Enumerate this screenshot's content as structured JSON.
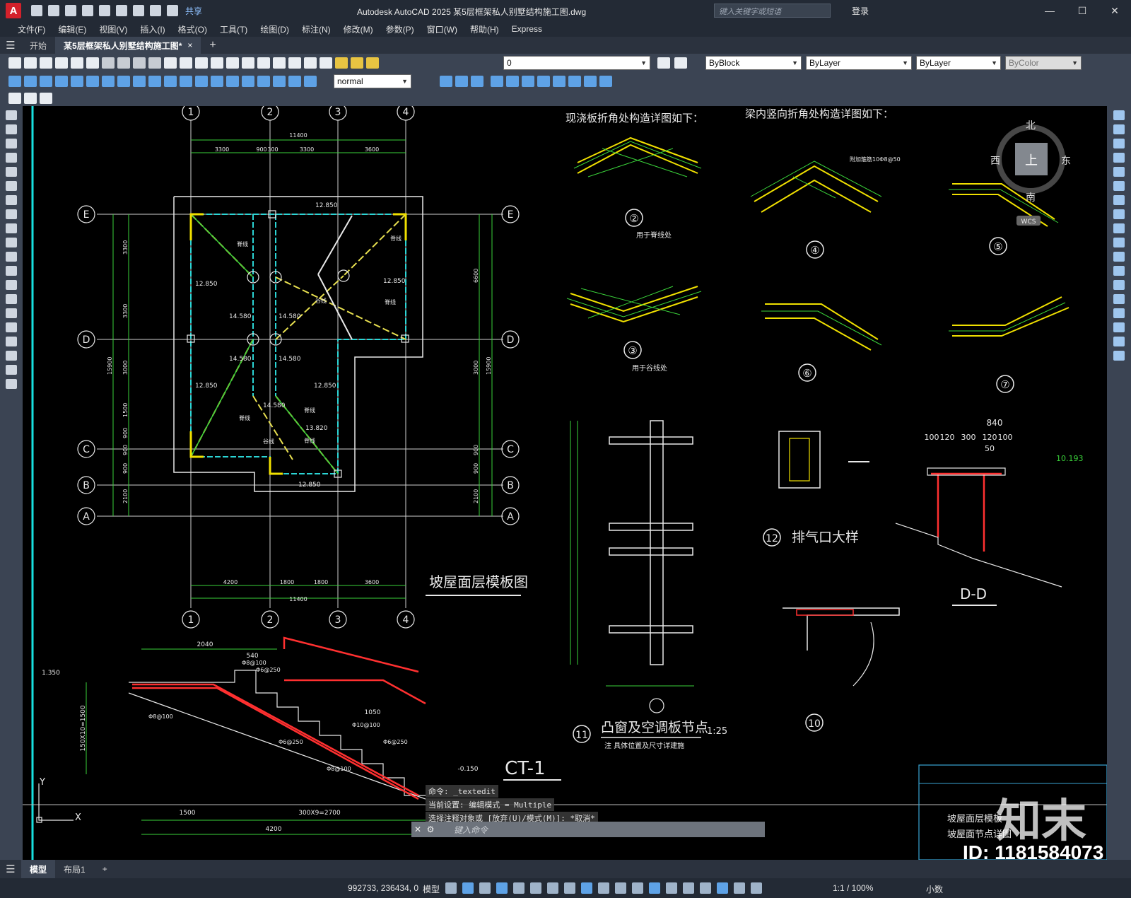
{
  "titlebar": {
    "logo": "A",
    "share": "共享",
    "title": "Autodesk AutoCAD 2025    某5层框架私人别墅结构施工图.dwg",
    "search_placeholder": "键入关键字或短语",
    "login": "登录",
    "minimize": "—",
    "maximize": "☐",
    "close": "✕"
  },
  "menu": [
    "文件(F)",
    "编辑(E)",
    "视图(V)",
    "插入(I)",
    "格式(O)",
    "工具(T)",
    "绘图(D)",
    "标注(N)",
    "修改(M)",
    "参数(P)",
    "窗口(W)",
    "帮助(H)",
    "Express"
  ],
  "tabs": {
    "start": "开始",
    "doc": "某5层框架私人别墅结构施工图*",
    "close": "×",
    "add": "+"
  },
  "toolbar": {
    "layer": "0",
    "color": "ByBlock",
    "linetype": "ByLayer",
    "lineweight": "ByLayer",
    "plotstyle": "ByColor",
    "textstyle": "normal"
  },
  "viewcube": {
    "north": "北",
    "south": "南",
    "east": "东",
    "west": "西",
    "top": "上",
    "wcs": "WCS"
  },
  "drawing": {
    "plan_title": "坡屋面层模板图",
    "axes_top": [
      "1",
      "2",
      "3",
      "4"
    ],
    "axes_side": [
      "E",
      "D",
      "C",
      "B",
      "A"
    ],
    "dim_total_top": "11400",
    "dims_top": [
      "3300",
      "900",
      "300",
      "3300",
      "3600"
    ],
    "dims_bottom": [
      "4200",
      "1800",
      "1800",
      "3600"
    ],
    "dim_total_bottom": "11400",
    "dims_left": [
      "3300",
      "3300",
      "3000",
      "1500",
      "900",
      "900",
      "900",
      "2100"
    ],
    "dim_left_total": "15900",
    "dims_right": [
      "6600",
      "3000",
      "900",
      "900",
      "2100"
    ],
    "dim_right_total": "15900",
    "elevations": [
      "12.850",
      "14.580",
      "14.580",
      "14.580",
      "14.580",
      "12.850",
      "12.850",
      "12.850",
      "12.850",
      "14.580",
      "13.820",
      "12.850"
    ],
    "ridge_label": "脊线",
    "valley_label": "谷线",
    "slab_title": "现浇板折角处构造详图如下：",
    "beam_title": "梁内竖向折角处构造详图如下：",
    "detail2": "②",
    "detail2_note": "用于脊线处",
    "detail3": "③",
    "detail3_note": "用于谷线处",
    "detail4": "④",
    "detail5": "⑤",
    "detail6": "⑥",
    "detail7": "⑦",
    "beam_rebar_note": "附加箍筋10Φ8@50",
    "section_11_title": "凸窗及空调板节点",
    "section_11_no": "11",
    "section_11_scale": "1:25",
    "section_11_note": "注 具体位置及尺寸详建施",
    "section_12_no": "12",
    "section_12_title": "排气口大样",
    "section_10_no": "10",
    "section_dd": "D-D",
    "dd_dims": [
      "840",
      "100",
      "120",
      "300",
      "120",
      "100",
      "50"
    ],
    "dd_elev": "10.193",
    "stair_title": "CT-1",
    "stair_dims": [
      "2040",
      "540",
      "1050",
      "1500",
      "300X9=2700",
      "4200",
      "150X10=1500"
    ],
    "stair_elevs": [
      "1.350",
      "-0.150"
    ],
    "stair_rebar": [
      "Φ8@100",
      "Φ6@250",
      "Φ8@100",
      "Φ6@250",
      "Φ10@100",
      "Φ6@250",
      "Φ8@100"
    ],
    "title_block_1": "坡屋面层模板",
    "title_block_2": "坡屋面节点详图"
  },
  "command": {
    "history": [
      "命令: _textedit",
      "当前设置: 编辑模式 = Multiple",
      "选择注释对象或 [放弃(U)/模式(M)]: *取消*"
    ],
    "placeholder": "键入命令"
  },
  "watermark": {
    "logo": "知末",
    "id": "ID: 1181584073"
  },
  "layout_tabs": [
    "模型",
    "布局1",
    "+"
  ],
  "status": {
    "coords": "992733, 236434, 0",
    "model": "模型",
    "scale": "1:1 / 100%",
    "units": "小数"
  }
}
